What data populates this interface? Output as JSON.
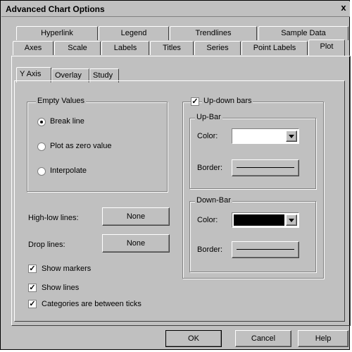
{
  "dialog": {
    "title": "Advanced Chart Options",
    "close_label": "x"
  },
  "tabs_row1": [
    "Hyperlink",
    "Legend",
    "Trendlines",
    "Sample Data"
  ],
  "tabs_row2": [
    "Axes",
    "Scale",
    "Labels",
    "Titles",
    "Series",
    "Point Labels",
    "Plot"
  ],
  "subtabs": [
    "Y Axis",
    "Overlay",
    "Study"
  ],
  "empty_values": {
    "title": "Empty Values",
    "options": [
      "Break line",
      "Plot as zero value",
      "Interpolate"
    ],
    "selected": "Break line"
  },
  "high_low": {
    "label": "High-low lines:",
    "value": "None"
  },
  "drop_lines": {
    "label": "Drop lines:",
    "value": "None"
  },
  "checks": {
    "show_markers": "Show markers",
    "show_lines": "Show lines",
    "between_ticks": "Categories are between ticks"
  },
  "updown": {
    "label": "Up-down bars",
    "up_bar": {
      "title": "Up-Bar",
      "color_label": "Color:",
      "border_label": "Border:",
      "color": "#ffffff"
    },
    "down_bar": {
      "title": "Down-Bar",
      "color_label": "Color:",
      "border_label": "Border:",
      "color": "#000000"
    }
  },
  "buttons": {
    "ok": "OK",
    "cancel": "Cancel",
    "help": "Help"
  }
}
